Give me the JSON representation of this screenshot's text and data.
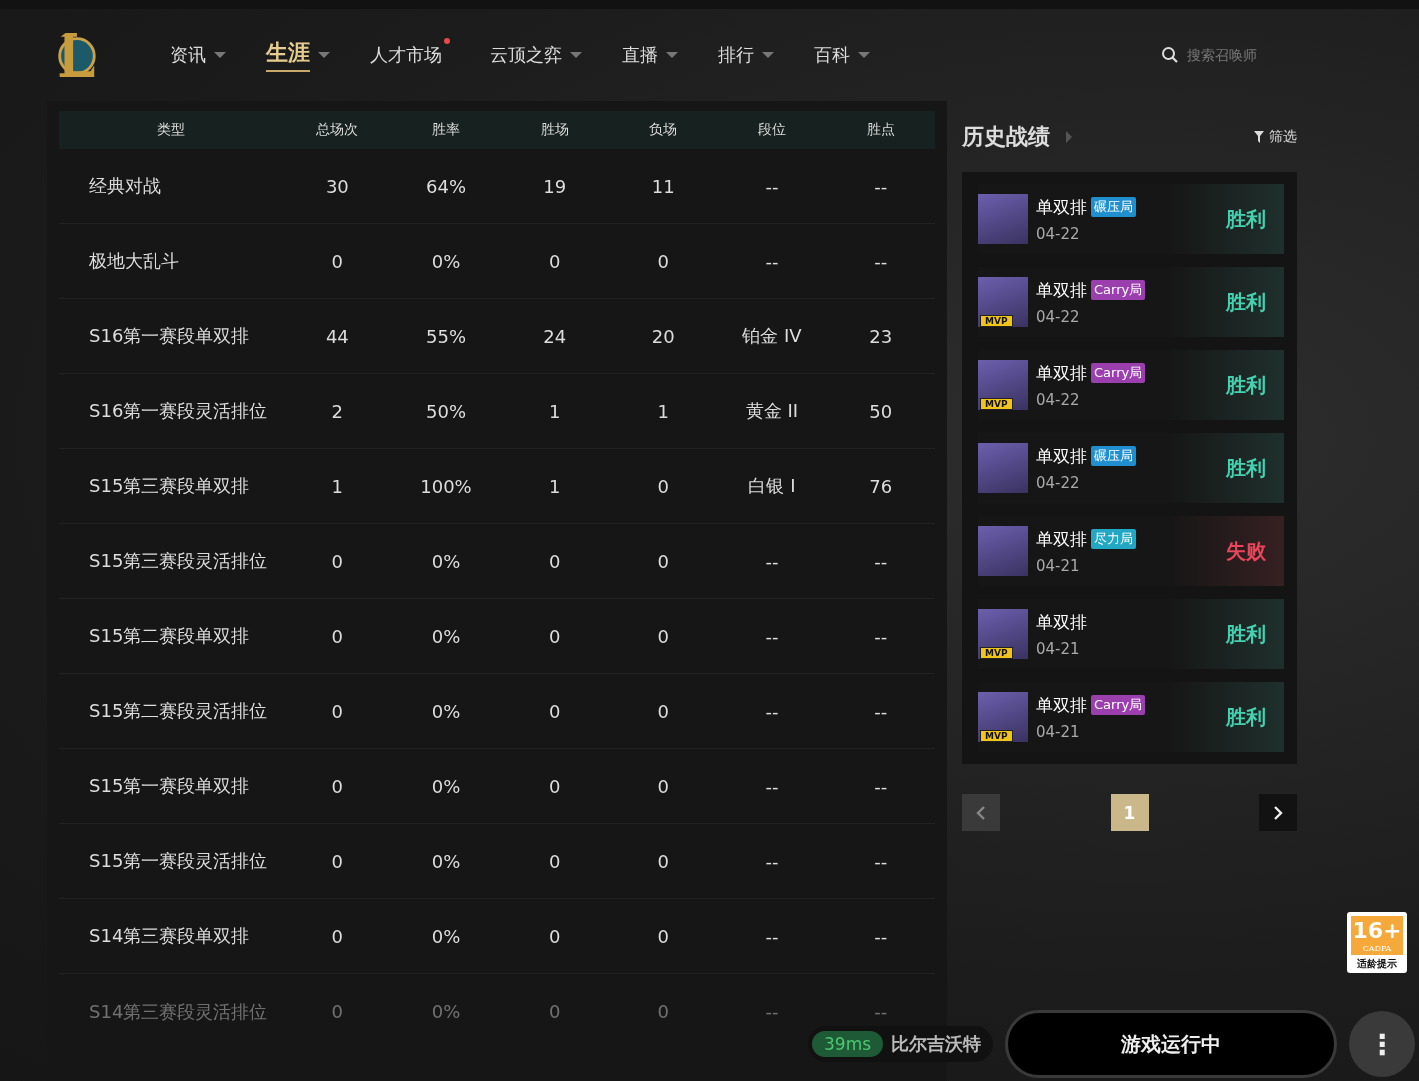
{
  "nav": {
    "items": [
      {
        "label": "资讯",
        "selected": false,
        "dropdown": true,
        "dot": false
      },
      {
        "label": "生涯",
        "selected": true,
        "dropdown": true,
        "dot": false
      },
      {
        "label": "人才市场",
        "selected": false,
        "dropdown": false,
        "dot": true
      },
      {
        "label": "云顶之弈",
        "selected": false,
        "dropdown": true,
        "dot": false
      },
      {
        "label": "直播",
        "selected": false,
        "dropdown": true,
        "dot": false
      },
      {
        "label": "排行",
        "selected": false,
        "dropdown": true,
        "dot": false
      },
      {
        "label": "百科",
        "selected": false,
        "dropdown": true,
        "dot": false
      }
    ],
    "search": {
      "placeholder": "搜索召唤师"
    }
  },
  "table": {
    "columns": [
      "类型",
      "总场次",
      "胜率",
      "胜场",
      "负场",
      "段位",
      "胜点"
    ],
    "rows": [
      [
        "经典对战",
        "30",
        "64%",
        "19",
        "11",
        "--",
        "--"
      ],
      [
        "极地大乱斗",
        "0",
        "0%",
        "0",
        "0",
        "--",
        "--"
      ],
      [
        "S16第一赛段单双排",
        "44",
        "55%",
        "24",
        "20",
        "铂金 IV",
        "23"
      ],
      [
        "S16第一赛段灵活排位",
        "2",
        "50%",
        "1",
        "1",
        "黄金 II",
        "50"
      ],
      [
        "S15第三赛段单双排",
        "1",
        "100%",
        "1",
        "0",
        "白银 I",
        "76"
      ],
      [
        "S15第三赛段灵活排位",
        "0",
        "0%",
        "0",
        "0",
        "--",
        "--"
      ],
      [
        "S15第二赛段单双排",
        "0",
        "0%",
        "0",
        "0",
        "--",
        "--"
      ],
      [
        "S15第二赛段灵活排位",
        "0",
        "0%",
        "0",
        "0",
        "--",
        "--"
      ],
      [
        "S15第一赛段单双排",
        "0",
        "0%",
        "0",
        "0",
        "--",
        "--"
      ],
      [
        "S15第一赛段灵活排位",
        "0",
        "0%",
        "0",
        "0",
        "--",
        "--"
      ],
      [
        "S14第三赛段单双排",
        "0",
        "0%",
        "0",
        "0",
        "--",
        "--"
      ],
      [
        "S14第三赛段灵活排位",
        "0",
        "0%",
        "0",
        "0",
        "--",
        "--"
      ]
    ]
  },
  "history": {
    "title": "历史战绩",
    "filter": "筛选",
    "matches": [
      {
        "mode": "单双排",
        "tag": {
          "text": "碾压局",
          "kind": "crush"
        },
        "date": "04-22",
        "mvp": false,
        "result": {
          "text": "胜利",
          "kind": "win"
        }
      },
      {
        "mode": "单双排",
        "tag": {
          "text": "Carry局",
          "kind": "carry"
        },
        "date": "04-22",
        "mvp": true,
        "mvp_text": "MVP",
        "result": {
          "text": "胜利",
          "kind": "win"
        }
      },
      {
        "mode": "单双排",
        "tag": {
          "text": "Carry局",
          "kind": "carry"
        },
        "date": "04-22",
        "mvp": true,
        "mvp_text": "MVP",
        "result": {
          "text": "胜利",
          "kind": "win"
        }
      },
      {
        "mode": "单双排",
        "tag": {
          "text": "碾压局",
          "kind": "crush"
        },
        "date": "04-22",
        "mvp": false,
        "result": {
          "text": "胜利",
          "kind": "win"
        }
      },
      {
        "mode": "单双排",
        "tag": {
          "text": "尽力局",
          "kind": "effort"
        },
        "date": "04-21",
        "mvp": false,
        "result": {
          "text": "失败",
          "kind": "lose"
        }
      },
      {
        "mode": "单双排",
        "date": "04-21",
        "mvp": true,
        "mvp_text": "MVP",
        "result": {
          "text": "胜利",
          "kind": "win"
        }
      },
      {
        "mode": "单双排",
        "tag": {
          "text": "Carry局",
          "kind": "carry"
        },
        "date": "04-21",
        "mvp": true,
        "mvp_text": "MVP",
        "result": {
          "text": "胜利",
          "kind": "win"
        }
      }
    ],
    "pages": [
      {
        "label": "1",
        "selected": true
      }
    ]
  },
  "bottom": {
    "ping": "39ms",
    "server": "比尔吉沃特",
    "play_button": "游戏运行中",
    "more_button": "⋮",
    "age_badge": {
      "rating": "16+",
      "org": "CADPA",
      "caption": "适龄提示"
    }
  }
}
